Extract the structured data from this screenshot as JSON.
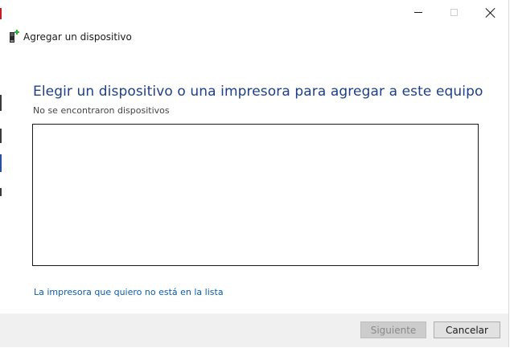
{
  "window": {
    "title": "Agregar un dispositivo",
    "caption_buttons": {
      "minimize_icon": "minimize-icon",
      "maximize_icon": "maximize-icon",
      "close_icon": "close-icon"
    }
  },
  "main": {
    "heading": "Elegir un dispositivo o una impresora para agregar a este equipo",
    "status": "No se encontraron dispositivos",
    "devices": [],
    "printer_link": "La impresora que quiero no está en la lista"
  },
  "footer": {
    "next_label": "Siguiente",
    "cancel_label": "Cancelar"
  },
  "colors": {
    "heading": "#1e3f8a",
    "link": "#0a5ea8",
    "footer_bg": "#f0f0f0",
    "icon_accent": "#2db53c"
  }
}
